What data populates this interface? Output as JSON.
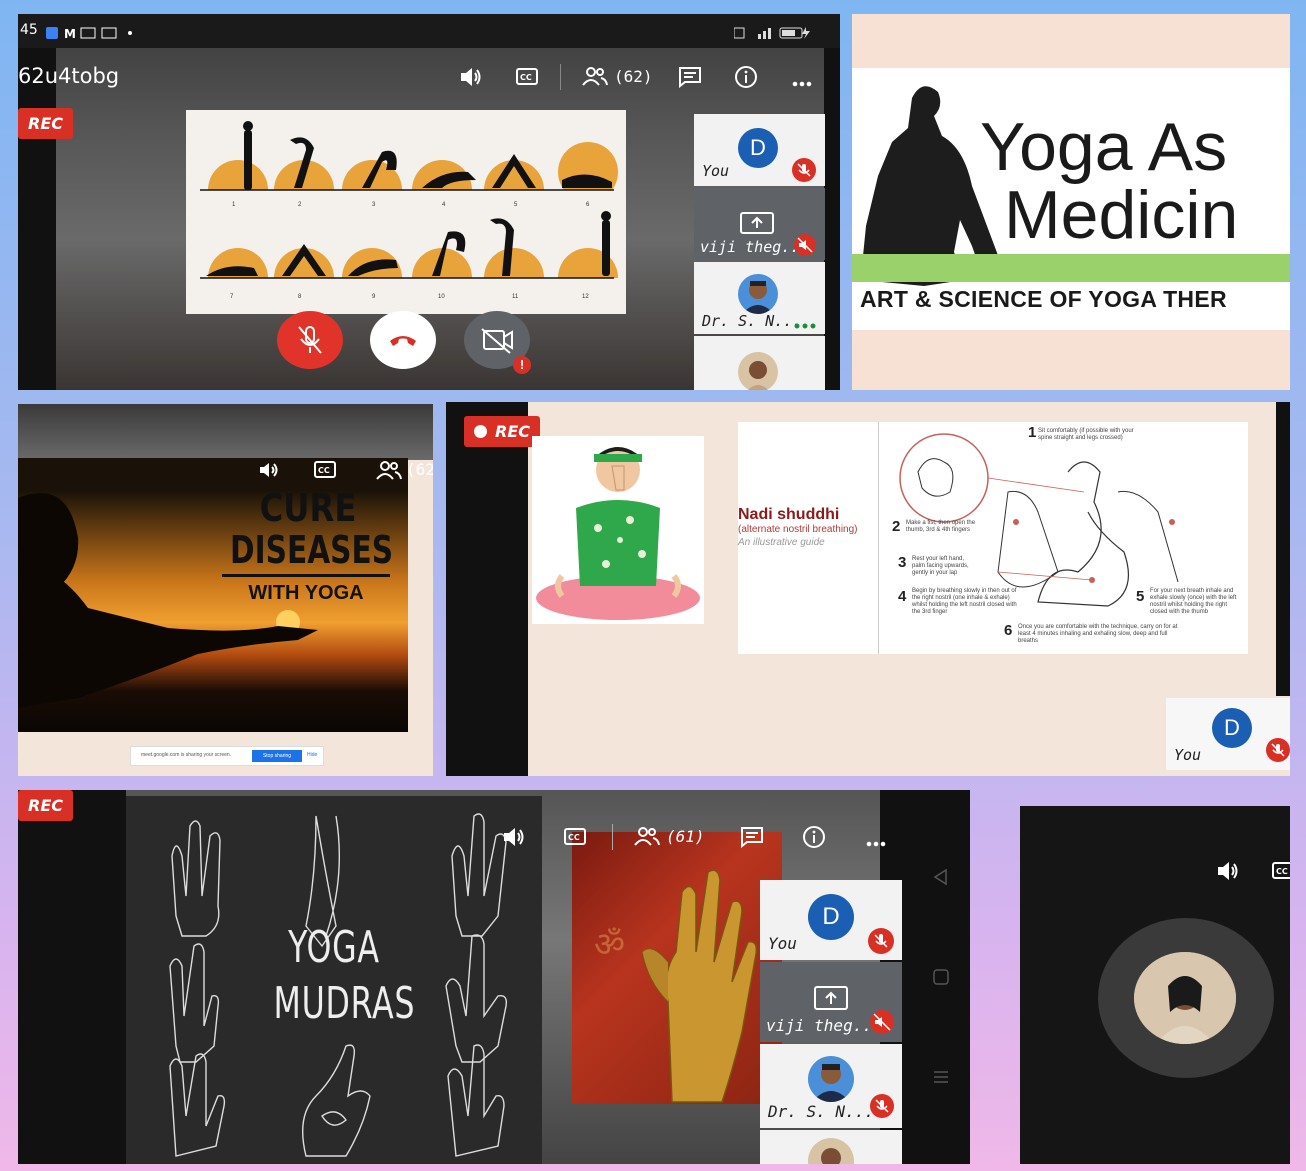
{
  "panel1": {
    "status_time": "45",
    "meeting_code": "62u4tobg",
    "participant_count": "(62)",
    "rec_label": "REC",
    "pose_numbers": [
      "1",
      "2",
      "3",
      "4",
      "5",
      "6",
      "7",
      "8",
      "9",
      "10",
      "11",
      "12"
    ],
    "tiles": [
      {
        "name": "You",
        "avatar_letter": "D"
      },
      {
        "name": "viji theg..."
      },
      {
        "name": "Dr. S. N..."
      }
    ]
  },
  "panel2": {
    "title_line1": "Yoga As",
    "title_line2": "Medicin",
    "subtitle": "ART & SCIENCE OF YOGA THER"
  },
  "panel3": {
    "participant_count": "(62",
    "cure": "CURE",
    "diseases": "DISEASES",
    "with_yoga": "WITH YOGA",
    "share_text": "meet.google.com is sharing your screen.",
    "stop_sharing": "Stop sharing",
    "hide": "Hide"
  },
  "panel4": {
    "rec_label": "REC",
    "heading": "Nadi shuddhi",
    "subheading": "(alternate nostril breathing)",
    "guide": "An illustrative guide",
    "steps": [
      {
        "n": "1",
        "text": "Sit comfortably (if possible with your spine straight and legs crossed)"
      },
      {
        "n": "2",
        "text": "Make a fist, then open the thumb, 3rd & 4th fingers"
      },
      {
        "n": "3",
        "text": "Rest your left hand, palm facing upwards, gently in your lap"
      },
      {
        "n": "4",
        "text": "Begin by breathing slowly in then out of the right nostril (one inhale & exhale) whilst holding the left nostril closed with the 3rd finger"
      },
      {
        "n": "5",
        "text": "For your next breath inhale and exhale slowly (once) with the left nostril whilst holding the right closed with the thumb"
      },
      {
        "n": "6",
        "text": "Once you are comfortable with the technique, carry on for at least 4 minutes inhaling and exhaling slow, deep and full breaths"
      }
    ],
    "self_tile": {
      "name": "You",
      "avatar_letter": "D"
    }
  },
  "panel5": {
    "rec_label": "REC",
    "mudra_line1": "YOGA",
    "mudra_line2": "MUDRAS",
    "participant_count": "(61)",
    "tiles": [
      {
        "name": "You",
        "avatar_letter": "D"
      },
      {
        "name": "viji theg..."
      },
      {
        "name": "Dr. S. N..."
      }
    ]
  },
  "colors": {
    "rec_red": "#d93025",
    "avatar_blue": "#1a5fb4",
    "green_bar": "#9bd16b",
    "stop_sharing_blue": "#1a73e8"
  }
}
